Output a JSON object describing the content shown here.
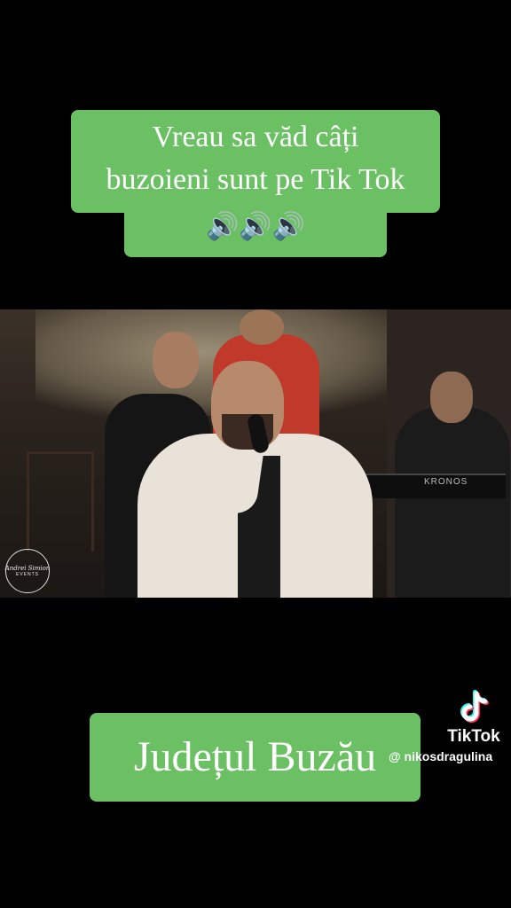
{
  "caption_top": {
    "line1": "Vreau sa văd câți",
    "line2": "buzoieni sunt pe Tik Tok",
    "emoji": "🔊🔊🔊",
    "background": "#6cc064"
  },
  "video": {
    "keyboard_brand": "KRONOS",
    "logo_text": "Andrei Simion",
    "logo_subtext": "EVENTS"
  },
  "caption_bottom": {
    "text": "Județul Buzău",
    "background": "#6cc064"
  },
  "watermark": {
    "icon": "tiktok-logo-icon",
    "brand": "TikTok",
    "handle": "@ nikosdragulina"
  }
}
